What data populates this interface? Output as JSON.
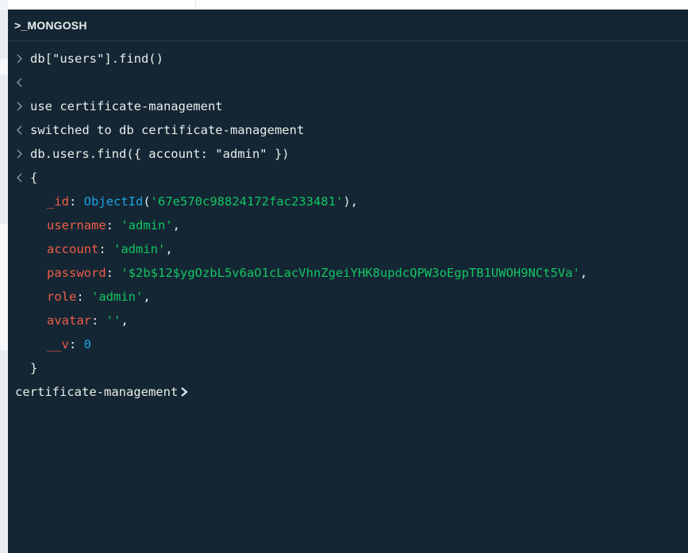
{
  "window": {
    "title": ">_MONGOSH"
  },
  "colors": {
    "background": "#142633",
    "text": "#e8edeb",
    "key": "#ef5d48",
    "string": "#13c465",
    "number": "#1aa3e6"
  },
  "history": [
    {
      "type": "input",
      "text": "db[\"users\"].find()"
    },
    {
      "type": "output",
      "text": ""
    },
    {
      "type": "input",
      "text": "use certificate-management"
    },
    {
      "type": "output",
      "text": "switched to db certificate-management"
    },
    {
      "type": "input",
      "text": "db.users.find({ account: \"admin\" })"
    }
  ],
  "result": {
    "open": "{",
    "close": "}",
    "fields": [
      {
        "key": "_id",
        "fn": "ObjectId",
        "value": "'67e570c98824172fac233481'",
        "suffix": "),"
      },
      {
        "key": "username",
        "value": "'admin'",
        "suffix": ","
      },
      {
        "key": "account",
        "value": "'admin'",
        "suffix": ","
      },
      {
        "key": "password",
        "value": "'$2b$12$ygOzbL5v6aO1cLacVhnZgeiYHK8updcQPW3oEgpTB1UWOH9NCt5Va'",
        "suffix": ","
      },
      {
        "key": "role",
        "value": "'admin'",
        "suffix": ","
      },
      {
        "key": "avatar",
        "value": "''",
        "suffix": ","
      },
      {
        "key": "__v",
        "value": "0",
        "suffix": ""
      }
    ]
  },
  "prompt": {
    "db_name": "certificate-management"
  },
  "icons": {
    "input_marker": "chevron-right-icon",
    "output_marker": "chevron-left-icon",
    "prompt_caret": "chevron-right-icon"
  }
}
